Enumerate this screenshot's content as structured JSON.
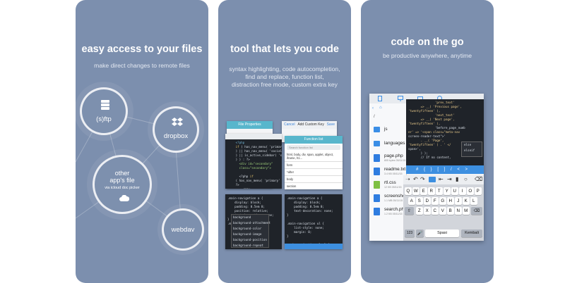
{
  "panels": [
    {
      "title": "easy access to your files",
      "subtitle": "make direct changes to remote files",
      "services": {
        "sftp": "(s)ftp",
        "dropbox": "dropbox",
        "other_line1": "other",
        "other_line2": "app's file",
        "other_caption": "via icloud doc picker",
        "webdav": "webdav"
      }
    },
    {
      "title": "tool that lets you code",
      "subtitle_lines": [
        "syntax highlighting, code autocompletion,",
        "find and replace, function list,",
        "distraction free mode, custom extra key"
      ],
      "mock": {
        "file_properties": "File Properties",
        "add_custom_key": "Add Custom Key",
        "cancel": "Cancel",
        "save": "Save",
        "function_list": "Function list",
        "search_fn": "Search function list",
        "fn_items": [
          "html, body, div, span, applet, object, iframe, h1...",
          "form",
          "*after",
          "body",
          "section"
        ],
        "css_props": [
          "background",
          "background-attachment",
          "background-color",
          "background-image",
          "background-position",
          "background-repeat"
        ]
      }
    },
    {
      "title": "code on the go",
      "subtitle": "be productive anywhere, anytime",
      "files": [
        {
          "name": "js",
          "meta": "",
          "color": "#3a8ee6"
        },
        {
          "name": "languages",
          "meta": "",
          "color": "#3a8ee6"
        },
        {
          "name": "page.php",
          "meta": "805 bytes 05/11/15",
          "color": "#2f7de0"
        },
        {
          "name": "readme.txt",
          "meta": "3.4 KB 05/11/15",
          "color": "#2f7de0"
        },
        {
          "name": "rtl.css",
          "meta": "12 KB 05/11/15",
          "color": "#7ec043"
        },
        {
          "name": "screenshot.png",
          "meta": "1.1 MB 05/11/15",
          "color": "#2f7de0"
        },
        {
          "name": "search.php",
          "meta": "1.2 KB 05/11/15",
          "color": "#2f7de0"
        }
      ],
      "breadcrumb": "/",
      "code_lines": [
        "               'prev_text'",
        "       => __( 'Previous page',",
        "'twentyfifteen' ),",
        "               'next_text'",
        "       => __( 'Next page',",
        "'twentyfifteen' ),",
        "               'before_page_numb",
        "er' => '<span class=\"meta-nav",
        "screen-reader-text\">'",
        "       . __( 'Page',",
        "'twentyfifteen' ) . ' </",
        "span>',",
        "       ) );",
        "",
        "       // If no content,"
      ],
      "autocomplete": [
        "else",
        "elseif"
      ],
      "extra_keys": [
        "#",
        "{",
        "}",
        "[",
        "]",
        "/",
        "<",
        ">"
      ],
      "kb_rows": [
        [
          "Q",
          "W",
          "E",
          "R",
          "T",
          "Y",
          "U",
          "I",
          "O",
          "P"
        ],
        [
          "A",
          "S",
          "D",
          "F",
          "G",
          "H",
          "J",
          "K",
          "L"
        ],
        [
          "Z",
          "X",
          "C",
          "V",
          "B",
          "N",
          "M"
        ]
      ],
      "kb_bottom": {
        "num": "123",
        "space": "Spasi",
        "return": "Kembali"
      }
    }
  ]
}
